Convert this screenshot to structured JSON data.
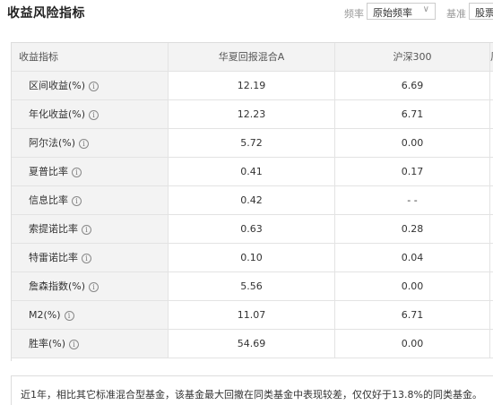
{
  "header": {
    "title": "收益风险指标",
    "frequency_label": "频率",
    "frequency_value": "原始频率",
    "benchmark_label": "基准",
    "benchmark_value": "股票型"
  },
  "table": {
    "headers": [
      "收益指标",
      "华夏回报混合A",
      "沪深300",
      "风"
    ],
    "rows": [
      {
        "label": "区间收益(%)",
        "a": "12.19",
        "b": "6.69"
      },
      {
        "label": "年化收益(%)",
        "a": "12.23",
        "b": "6.71"
      },
      {
        "label": "阿尔法(%)",
        "a": "5.72",
        "b": "0.00"
      },
      {
        "label": "夏普比率",
        "a": "0.41",
        "b": "0.17"
      },
      {
        "label": "信息比率",
        "a": "0.42",
        "b": "- -"
      },
      {
        "label": "索提诺比率",
        "a": "0.63",
        "b": "0.28"
      },
      {
        "label": "特雷诺比率",
        "a": "0.10",
        "b": "0.04"
      },
      {
        "label": "詹森指数(%)",
        "a": "5.56",
        "b": "0.00"
      },
      {
        "label": "M2(%)",
        "a": "11.07",
        "b": "6.71"
      },
      {
        "label": "胜率(%)",
        "a": "54.69",
        "b": "0.00"
      }
    ],
    "info_glyph": "i"
  },
  "summary": "近1年，相比其它标准混合型基金，该基金最大回撤在同类基金中表现较差，仅仅好于13.8%的同类基金。",
  "icons": {
    "chevron": "chevron-down-icon",
    "info": "info-circle-icon"
  }
}
